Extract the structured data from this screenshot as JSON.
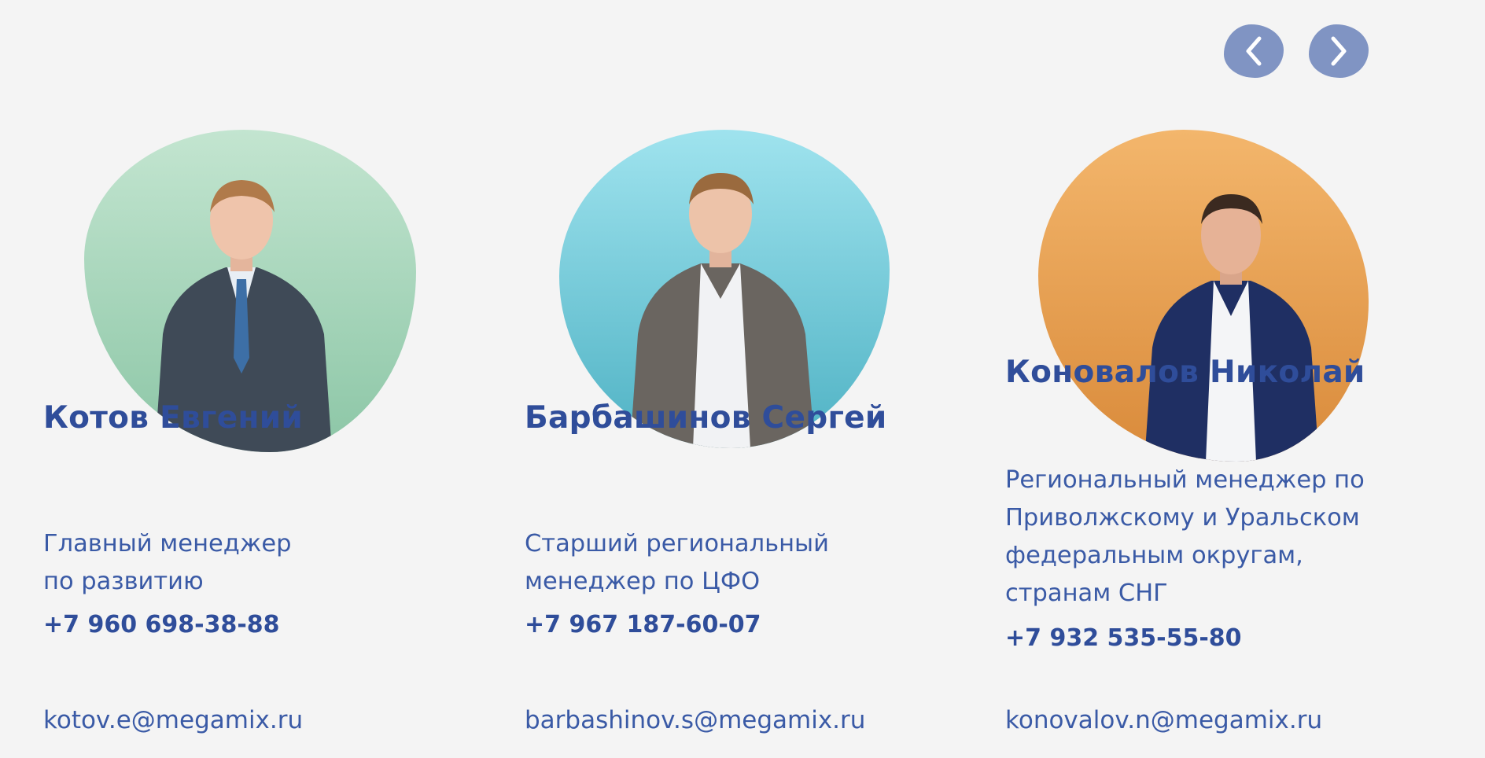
{
  "carousel": {
    "prev_icon": "chevron-left-icon",
    "next_icon": "chevron-right-icon",
    "button_color": "#8094c3"
  },
  "contacts": [
    {
      "name": "Котов Евгений",
      "role_lines": [
        "Главный менеджер",
        "по развитию"
      ],
      "phone": "+7 960 698-38-88",
      "email": "kotov.e@megamix.ru",
      "blob_color_top": "#bfe3cc",
      "blob_color_bottom": "#8cc6a6"
    },
    {
      "name": "Барбашинов Сергей",
      "role_lines": [
        "Старший региональный",
        "менеджер по ЦФО"
      ],
      "phone": "+7 967 187-60-07",
      "email": "barbashinov.s@megamix.ru",
      "blob_color_top": "#9ee4ee",
      "blob_color_bottom": "#4fb2c4"
    },
    {
      "name": "Коновалов Николай",
      "role_lines": [
        "Региональный менеджер по",
        "Приволжскому и Уральском",
        "федеральным округам,",
        "странам СНГ"
      ],
      "phone": "+7 932 535-55-80",
      "email": "konovalov.n@megamix.ru",
      "blob_color_top": "#f3b56a",
      "blob_color_bottom": "#d98a3a"
    }
  ]
}
